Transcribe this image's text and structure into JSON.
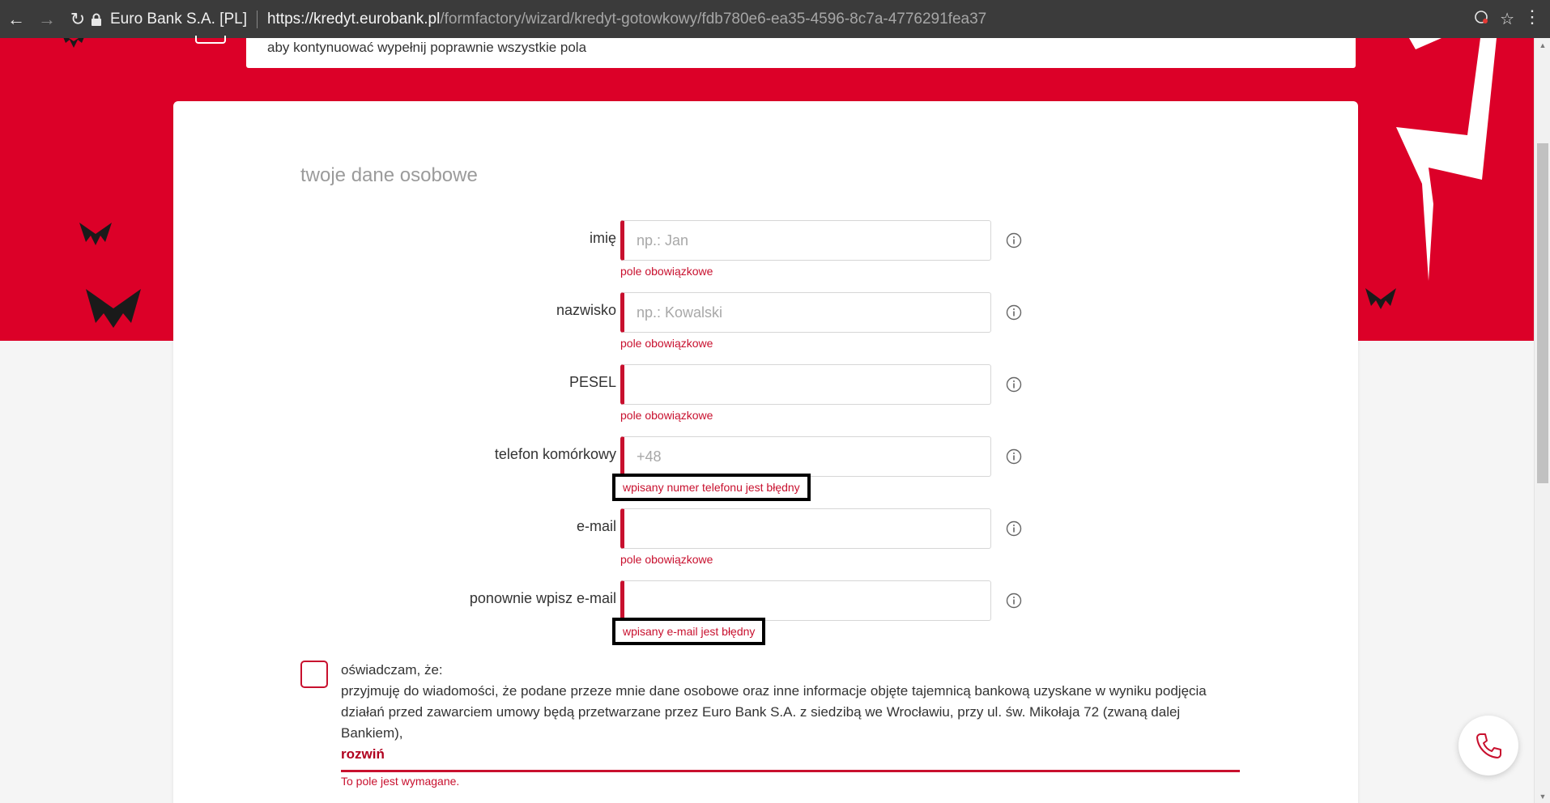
{
  "browser": {
    "site_name": "Euro Bank S.A. [PL]",
    "url_host": "https://kredyt.eurobank.pl",
    "url_path": "/formfactory/wizard/kredyt-gotowkowy/fdb780e6-ea35-4596-8c7a-4776291fea37"
  },
  "notice": {
    "text": "aby kontynuować wypełnij poprawnie wszystkie pola"
  },
  "form": {
    "section_title": "twoje dane osobowe",
    "fields": [
      {
        "label": "imię",
        "placeholder": "np.: Jan",
        "value": "",
        "error": "pole obowiązkowe",
        "error_highlighted": false
      },
      {
        "label": "nazwisko",
        "placeholder": "np.: Kowalski",
        "value": "",
        "error": "pole obowiązkowe",
        "error_highlighted": false
      },
      {
        "label": "PESEL",
        "placeholder": "",
        "value": "",
        "error": "pole obowiązkowe",
        "error_highlighted": false
      },
      {
        "label": "telefon komórkowy",
        "placeholder": "+48",
        "value": "",
        "error": "wpisany numer telefonu jest błędny",
        "error_highlighted": true
      },
      {
        "label": "e-mail",
        "placeholder": "",
        "value": "",
        "error": "pole obowiązkowe",
        "error_highlighted": false
      },
      {
        "label": "ponownie wpisz e-mail",
        "placeholder": "",
        "value": "",
        "error": "wpisany e-mail jest błędny",
        "error_highlighted": true
      }
    ]
  },
  "consent": {
    "text": "oświadczam, że:\nprzyjmuję do wiadomości, że podane przeze mnie dane osobowe oraz inne informacje objęte tajemnicą bankową uzyskane w wyniku podjęcia działań przed zawarciem umowy będą przetwarzane przez Euro Bank S.A. z siedzibą we Wrocławiu, przy ul. św. Mikołaja 72 (zwaną dalej Bankiem),",
    "expand_label": "rozwiń",
    "error": "To pole jest wymagane.",
    "checked": false
  },
  "colors": {
    "brand_red": "#dc0028",
    "error_red": "#c8102e"
  },
  "icons": {
    "info": "info-icon",
    "phone": "phone-icon",
    "lock": "lock-icon"
  }
}
